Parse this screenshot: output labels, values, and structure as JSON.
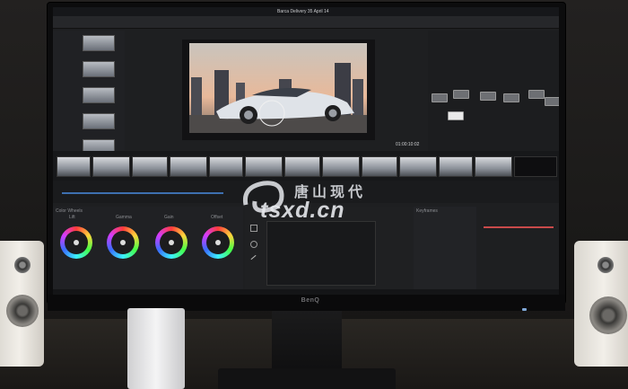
{
  "window_title": "Barca Delivery 35 April 14",
  "monitor_brand": "BenQ",
  "watermark": {
    "chinese": "唐山现代",
    "latin": "tsxd.cn"
  },
  "viewer_timecode": "01:00:10:02",
  "panels": {
    "color_wheels_title": "Color Wheels",
    "keyframes_title": "Keyframes"
  },
  "wheels": [
    "Lift",
    "Gamma",
    "Gain",
    "Offset"
  ],
  "colors": {
    "accent": "#e64b4b",
    "ui_bg": "#1e1f21",
    "screen_bezel": "#0c0c0d"
  }
}
